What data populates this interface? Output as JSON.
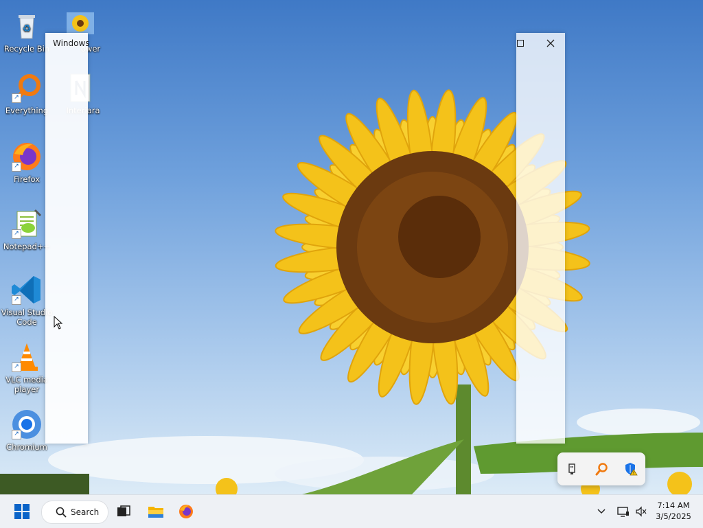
{
  "desktop": {
    "icons": [
      {
        "label": "Recycle Bin"
      },
      {
        "label": "Everything"
      },
      {
        "label": "Firefox"
      },
      {
        "label": "Notepad++"
      },
      {
        "label": "Visual Studio Code"
      },
      {
        "label": "VLC media player"
      },
      {
        "label": "Chromium"
      },
      {
        "label": "ower"
      },
      {
        "label": "Interiara"
      }
    ]
  },
  "windows": {
    "left_ghost_title": "Windows",
    "right_ghost_controls": [
      "maximize-icon",
      "close-icon"
    ]
  },
  "tray_overflow": {
    "items": [
      "usb-eject-icon",
      "everything-search-icon",
      "security-warning-icon"
    ]
  },
  "taskbar": {
    "search_label": "Search",
    "pinned": [
      "start-icon",
      "task-view-icon",
      "file-explorer-icon",
      "firefox-icon"
    ],
    "tray": [
      "chevron-up-icon",
      "network-icon",
      "volume-muted-icon"
    ],
    "time": "7:14 AM",
    "date": "3/5/2025"
  },
  "colors": {
    "accent": "#0a64c8",
    "taskbar_bg": "#eef1f5"
  }
}
